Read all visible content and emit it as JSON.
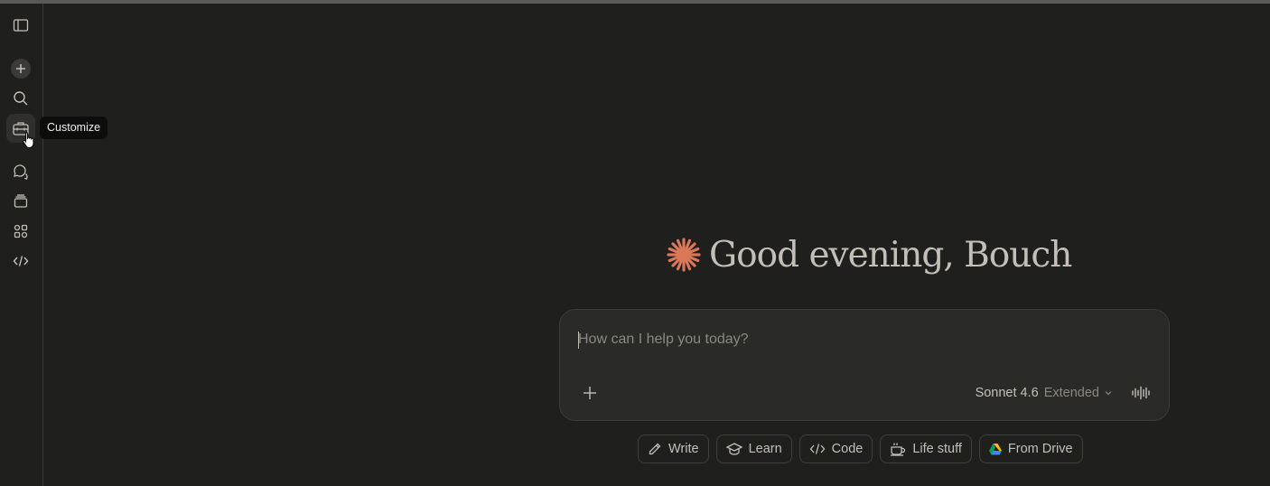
{
  "tooltip": {
    "text": "Customize"
  },
  "sidebar": {
    "items": [
      {
        "icon": "sidebar-toggle-icon"
      },
      {
        "icon": "new-chat-icon"
      },
      {
        "icon": "search-icon"
      },
      {
        "icon": "customize-icon"
      },
      {
        "icon": "chats-icon"
      },
      {
        "icon": "projects-icon"
      },
      {
        "icon": "artifacts-icon"
      },
      {
        "icon": "code-icon"
      }
    ]
  },
  "greeting": {
    "text": "Good evening, Bouch"
  },
  "composer": {
    "placeholder": "How can I help you today?",
    "model_name": "Sonnet 4.6",
    "model_mode": "Extended"
  },
  "chips": [
    {
      "label": "Write",
      "icon": "pencil-icon"
    },
    {
      "label": "Learn",
      "icon": "graduation-cap-icon"
    },
    {
      "label": "Code",
      "icon": "code-icon"
    },
    {
      "label": "Life stuff",
      "icon": "coffee-cup-icon"
    },
    {
      "label": "From Drive",
      "icon": "google-drive-icon"
    }
  ],
  "colors": {
    "background": "#1f1f1e",
    "accent": "#d97757",
    "text": "#c2c0b6"
  }
}
